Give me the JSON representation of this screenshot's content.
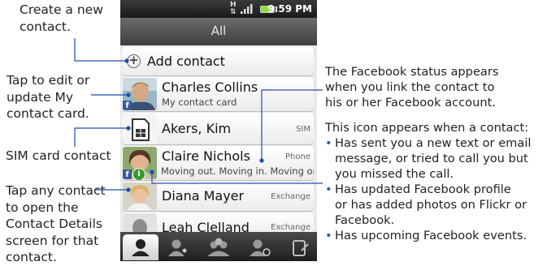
{
  "callouts": {
    "create_contact": "Create a new\ncontact.",
    "edit_my_card": "Tap to edit or\nupdate My\ncontact card.",
    "sim_contact": "SIM card contact",
    "open_details": "Tap any contact\nto open the\nContact Details\nscreen for that\ncontact.",
    "facebook_status": "The Facebook status appears\nwhen you link the contact to\nhis or her Facebook account.",
    "icon_intro": "This icon appears when a contact:",
    "icon_bullets": [
      "Has sent you a new text or email\nmessage, or tried to call you but\nyou missed the call.",
      "Has updated Facebook profile\nor has added photos on Flickr or\nFacebook.",
      "Has upcoming Facebook events."
    ]
  },
  "phone": {
    "status_time": "9:59 PM",
    "title": "All",
    "add_contact_label": "Add contact",
    "contacts": [
      {
        "name": "Charles Collins",
        "subtitle": "My contact card",
        "tag": ""
      },
      {
        "name": "Akers, Kim",
        "subtitle": "",
        "tag": "SIM"
      },
      {
        "name": "Claire Nichols",
        "subtitle": "Moving out. Moving in. Moving on",
        "tag": "Phone"
      },
      {
        "name": "Diana Mayer",
        "subtitle": "",
        "tag": "Exchange"
      },
      {
        "name": "Leah Clelland",
        "subtitle": "",
        "tag": "Exchange"
      }
    ],
    "facebook_badge": "f",
    "update_badge": "i"
  },
  "colors": {
    "leader_line": "#1f4fa6",
    "facebook_blue": "#3b5998",
    "update_green": "#3a9a2a",
    "battery_green": "#8de03c"
  },
  "icons": [
    "add-icon",
    "sim-card-icon",
    "facebook-icon",
    "notification-icon",
    "people-tab-icon",
    "favorites-tab-icon",
    "groups-tab-icon",
    "call-history-tab-icon",
    "updates-tab-icon"
  ]
}
